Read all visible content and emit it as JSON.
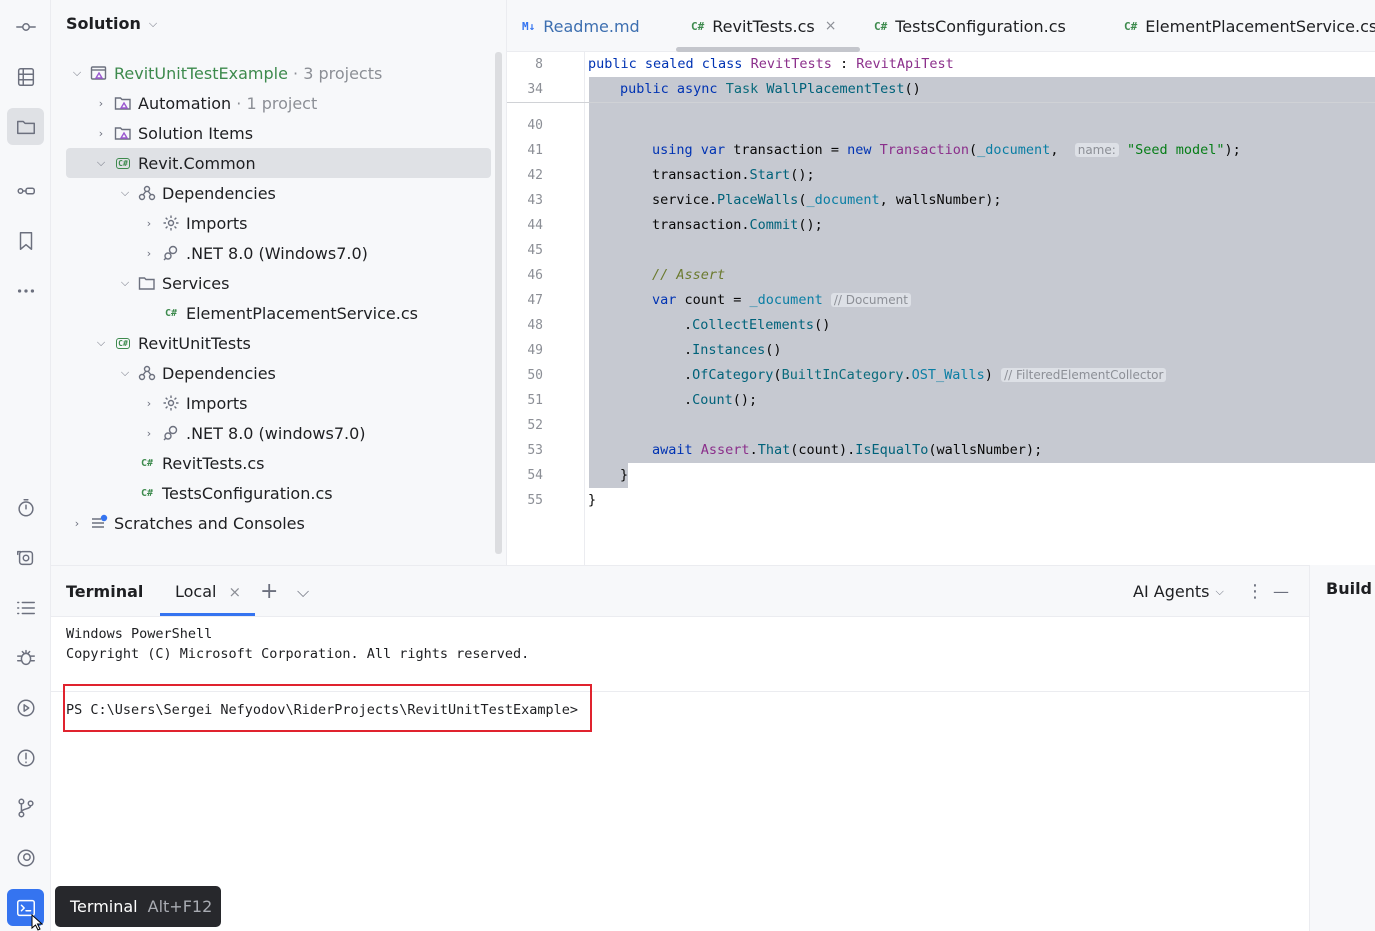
{
  "solution": {
    "title": "Solution",
    "items": [
      {
        "label": "RevitUnitTestExample",
        "suffix": "· 3 projects"
      },
      {
        "label": "Automation",
        "suffix": "· 1 project"
      },
      {
        "label": "Solution Items"
      },
      {
        "label": "Revit.Common"
      },
      {
        "label": "Dependencies"
      },
      {
        "label": "Imports"
      },
      {
        "label": ".NET 8.0 (Windows7.0)"
      },
      {
        "label": "Services"
      },
      {
        "label": "ElementPlacementService.cs"
      },
      {
        "label": "RevitUnitTests"
      },
      {
        "label": "Dependencies"
      },
      {
        "label": "Imports"
      },
      {
        "label": ".NET 8.0 (windows7.0)"
      },
      {
        "label": "RevitTests.cs"
      },
      {
        "label": "TestsConfiguration.cs"
      },
      {
        "label": "Scratches and Consoles"
      }
    ]
  },
  "editor": {
    "tabs": [
      {
        "icon": "M↓",
        "label": "Readme.md"
      },
      {
        "icon": "C#",
        "label": "RevitTests.cs",
        "close": "×"
      },
      {
        "icon": "C#",
        "label": "TestsConfiguration.cs"
      },
      {
        "icon": "C#",
        "label": "ElementPlacementService.cs"
      }
    ],
    "line_numbers": [
      "8",
      "34",
      "40",
      "41",
      "42",
      "43",
      "44",
      "45",
      "46",
      "47",
      "48",
      "49",
      "50",
      "51",
      "52",
      "53",
      "54",
      "55"
    ],
    "code": {
      "l8": {
        "kw": "public sealed class",
        "name": "RevitTests",
        "colon": " : ",
        "base": "RevitApiTest"
      },
      "l34": {
        "kw": "public async",
        "type": "Task",
        "name": "WallPlacementTest",
        "rest": "()"
      },
      "l41": {
        "kw1": "using var",
        "var": " transaction = ",
        "kw2": "new",
        "type": "Transaction",
        "p1": "(",
        "field": "_document",
        "p2": ", ",
        "hint": "name:",
        "str": "\"Seed model\"",
        "end": ");"
      },
      "l42": {
        "obj": "transaction.",
        "m": "Start",
        "end": "();"
      },
      "l43": {
        "obj": "service.",
        "m": "PlaceWalls",
        "p1": "(",
        "field": "_document",
        "p2": ", wallsNumber);"
      },
      "l44": {
        "obj": "transaction.",
        "m": "Commit",
        "end": "();"
      },
      "l46": {
        "comment": "// Assert"
      },
      "l47": {
        "kw": "var",
        "var": " count = ",
        "field": "_document",
        "hint": "// Document"
      },
      "l48": {
        "dot": ".",
        "m": "CollectElements",
        "end": "()"
      },
      "l49": {
        "dot": ".",
        "m": "Instances",
        "end": "()"
      },
      "l50": {
        "dot": ".",
        "m": "OfCategory",
        "p1": "(",
        "type": "BuiltInCategory",
        "dot2": ".",
        "field": "OST_Walls",
        "p2": ")",
        "hint": "// FilteredElementCollector"
      },
      "l51": {
        "dot": ".",
        "m": "Count",
        "end": "();"
      },
      "l53": {
        "kw": "await",
        "type": "Assert",
        "dot": ".",
        "m1": "That",
        "mid": "(count).",
        "m2": "IsEqualTo",
        "end": "(wallsNumber);"
      },
      "l54": {
        "brace": "}"
      },
      "l55": {
        "brace": "}"
      }
    }
  },
  "terminal": {
    "title": "Terminal",
    "tab_label": "Local",
    "tab_close": "×",
    "add": "+",
    "dropdown": "⌵",
    "ai_agents": "AI Agents",
    "more": "⋮",
    "minimize": "—",
    "output": [
      "Windows PowerShell",
      "Copyright (C) Microsoft Corporation. All rights reserved."
    ],
    "prompt": "PS C:\\Users\\Sergei Nefyodov\\RiderProjects\\RevitUnitTestExample>"
  },
  "build": {
    "title": "Build"
  },
  "tooltip": {
    "label": "Terminal",
    "shortcut": "Alt+F12"
  },
  "icons": [
    "commit-icon",
    "structure-icon",
    "folder-icon",
    "pull-requests-icon",
    "bookmark-icon",
    "more-icon",
    "timer-icon",
    "unit-tests-icon",
    "todo-icon",
    "debug-icon",
    "run-icon",
    "problems-icon",
    "git-icon",
    "services-icon",
    "terminal-icon"
  ]
}
